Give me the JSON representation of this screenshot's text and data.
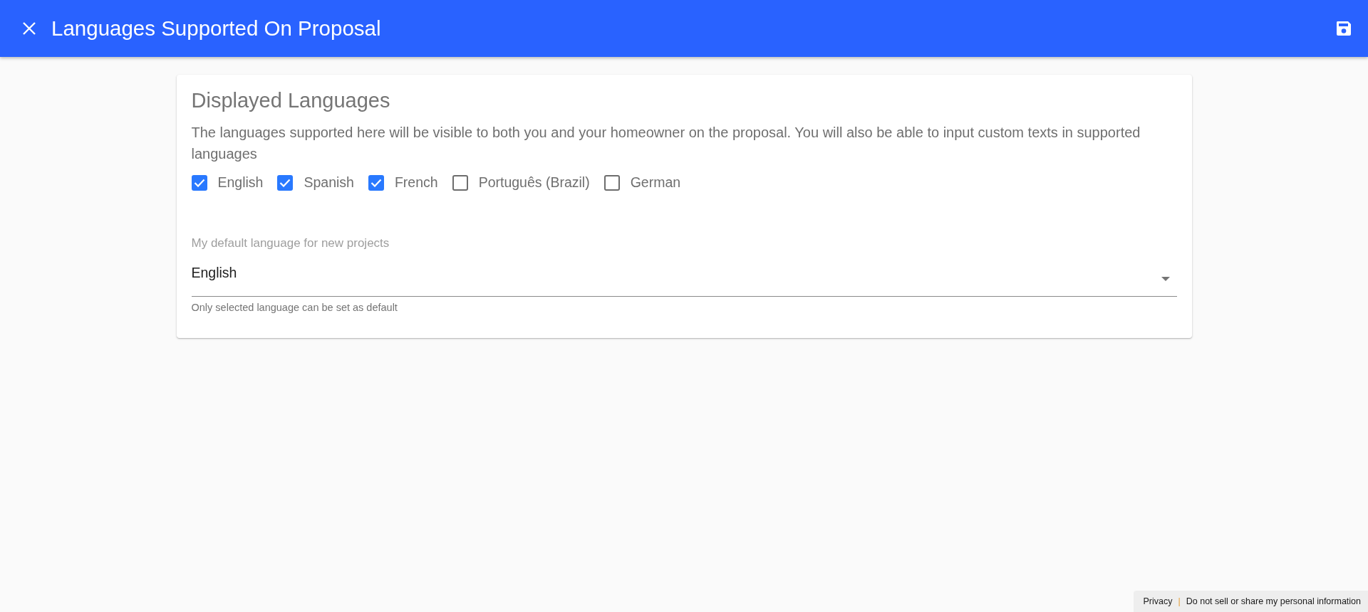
{
  "header": {
    "title": "Languages Supported On Proposal"
  },
  "card": {
    "heading": "Displayed Languages",
    "description": "The languages supported here will be visible to both you and your homeowner on the proposal. You will also be able to input custom texts in supported languages",
    "languages": [
      {
        "label": "English",
        "checked": true
      },
      {
        "label": "Spanish",
        "checked": true
      },
      {
        "label": "French",
        "checked": true
      },
      {
        "label": "Português (Brazil)",
        "checked": false
      },
      {
        "label": "German",
        "checked": false
      }
    ],
    "default_language": {
      "label": "My default language for new projects",
      "value": "English",
      "helper": "Only selected language can be set as default"
    }
  },
  "footer": {
    "links": [
      {
        "label": "Privacy"
      },
      {
        "label": "Do not sell or share my personal information"
      }
    ],
    "separator": "|"
  }
}
